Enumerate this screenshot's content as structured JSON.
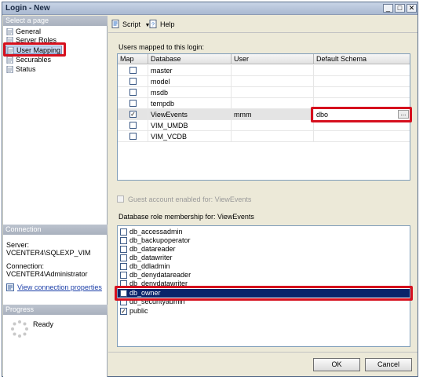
{
  "window": {
    "title": "Login - New"
  },
  "left": {
    "select_page_header": "Select a page",
    "pages": [
      {
        "label": "General",
        "icon": "page-icon"
      },
      {
        "label": "Server Roles",
        "icon": "page-icon"
      },
      {
        "label": "User Mapping",
        "icon": "page-icon"
      },
      {
        "label": "Securables",
        "icon": "page-icon"
      },
      {
        "label": "Status",
        "icon": "page-icon"
      }
    ],
    "connection_header": "Connection",
    "server_label": "Server:",
    "server_value": "VCENTER4\\SQLEXP_VIM",
    "connection_label": "Connection:",
    "connection_value": "VCENTER4\\Administrator",
    "view_props_link": "View connection properties",
    "progress_header": "Progress",
    "progress_status": "Ready"
  },
  "toolbar": {
    "script_label": "Script",
    "help_label": "Help"
  },
  "mapping": {
    "section_label": "Users mapped to this login:",
    "columns": [
      "Map",
      "Database",
      "User",
      "Default Schema"
    ],
    "rows": [
      {
        "map": false,
        "database": "master",
        "user": "",
        "schema": ""
      },
      {
        "map": false,
        "database": "model",
        "user": "",
        "schema": ""
      },
      {
        "map": false,
        "database": "msdb",
        "user": "",
        "schema": ""
      },
      {
        "map": false,
        "database": "tempdb",
        "user": "",
        "schema": ""
      },
      {
        "map": true,
        "database": "ViewEvents",
        "user": "mmm",
        "schema": "dbo"
      },
      {
        "map": false,
        "database": "VIM_UMDB",
        "user": "",
        "schema": ""
      },
      {
        "map": false,
        "database": "VIM_VCDB",
        "user": "",
        "schema": ""
      }
    ],
    "ellipsis": "...",
    "guest_label": "Guest account enabled for: ViewEvents"
  },
  "roles": {
    "section_label": "Database role membership for: ViewEvents",
    "items": [
      {
        "label": "db_accessadmin",
        "checked": false
      },
      {
        "label": "db_backupoperator",
        "checked": false
      },
      {
        "label": "db_datareader",
        "checked": false
      },
      {
        "label": "db_datawriter",
        "checked": false
      },
      {
        "label": "db_ddladmin",
        "checked": false
      },
      {
        "label": "db_denydatareader",
        "checked": false
      },
      {
        "label": "db_denydatawriter",
        "checked": false
      },
      {
        "label": "db_owner",
        "checked": true
      },
      {
        "label": "db_securityadmin",
        "checked": false
      },
      {
        "label": "public",
        "checked": true
      }
    ]
  },
  "buttons": {
    "ok": "OK",
    "cancel": "Cancel"
  },
  "colors": {
    "highlight": "#d6101e",
    "selection": "#0a246a"
  }
}
